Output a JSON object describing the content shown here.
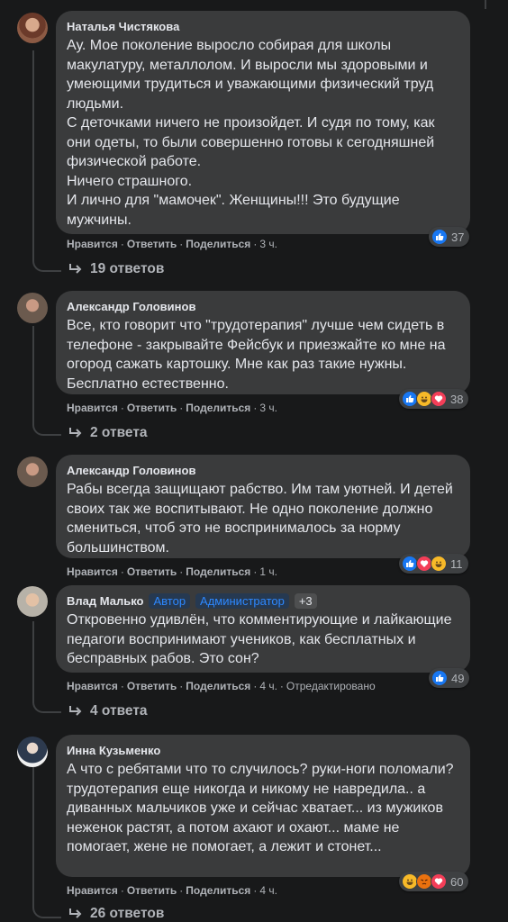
{
  "comments": [
    {
      "author": "Наталья Чистякова",
      "text": "Ау. Мое поколение выросло собирая для школы макулатуру, металлолом. И выросли мы здоровыми и умеющими трудиться и уважающими физический труд людьми.\nС деточками ничего не произойдет. И судя по тому, как они одеты, то были совершенно готовы к сегодняшней физической работе.\nНичего страшного.\nИ лично для \"мамочек\". Женщины!!! Это будущие мужчины.",
      "reactions": [
        "like"
      ],
      "reaction_count": "37",
      "like": "Нравится",
      "reply": "Ответить",
      "share": "Поделиться",
      "time": "3 ч.",
      "replies": "19 ответов"
    },
    {
      "author": "Александр Головинов",
      "text": "Все, кто говорит что \"трудотерапия\" лучше чем сидеть в телефоне - закрывайте Фейсбук и приезжайте ко мне на огород сажать картошку. Мне как раз такие нужны. Бесплатно естественно.",
      "reactions": [
        "like",
        "haha",
        "love"
      ],
      "reaction_count": "38",
      "like": "Нравится",
      "reply": "Ответить",
      "share": "Поделиться",
      "time": "3 ч.",
      "replies": "2 ответа"
    },
    {
      "author": "Александр Головинов",
      "text": "Рабы всегда защищают рабство. Им там уютней. И детей своих так же воспитывают. Не одно поколение должно смениться, чтоб это не воспринималось за норму большинством.",
      "reactions": [
        "like",
        "love",
        "haha"
      ],
      "reaction_count": "11",
      "like": "Нравится",
      "reply": "Ответить",
      "share": "Поделиться",
      "time": "1 ч."
    },
    {
      "author": "Влад Малько",
      "badges": [
        "Автор",
        "Администратор"
      ],
      "badge_more": "+3",
      "text": "Откровенно удивлён, что комментирующие и лайкающие педагоги воспринимают учеников, как бесплатных и бесправных рабов. Это сон?",
      "reactions": [
        "like"
      ],
      "reaction_count": "49",
      "like": "Нравится",
      "reply": "Ответить",
      "share": "Поделиться",
      "time": "4 ч.",
      "edited": "Отредактировано",
      "replies": "4 ответа"
    },
    {
      "author": "Инна Кузьменко",
      "text": "А что с ребятами что то случилось? руки-ноги поломали? трудотерапия еще никогда и никому не навредила.. а диванных мальчиков уже и сейчас хватает... из мужиков неженок растят, а потом ахают и охают... маме не помогает, жене не помогает, а лежит и стонет...",
      "reactions": [
        "haha",
        "angry",
        "love"
      ],
      "reaction_count": "60",
      "like": "Нравится",
      "reply": "Ответить",
      "share": "Поделиться",
      "time": "4 ч.",
      "replies": "26 ответов"
    }
  ],
  "colors": {
    "background": "#18191a",
    "bubble": "#3a3b3c",
    "text": "#e4e6eb",
    "muted": "#b0b3b8",
    "like": "#1877f2",
    "love": "#f33e58",
    "haha": "#f7b928",
    "badge": "#2d88ff"
  }
}
